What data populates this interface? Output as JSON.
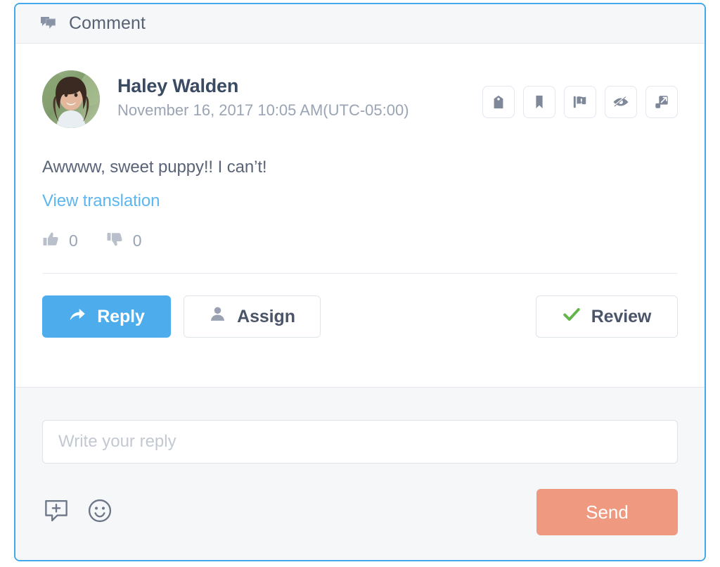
{
  "card": {
    "border_color": "#45a8ec",
    "header": {
      "icon": "comment-bubbles-icon",
      "title": "Comment"
    }
  },
  "comment": {
    "author": "Haley Walden",
    "timestamp": "November 16, 2017 10:05 AM(UTC-05:00)",
    "avatar_alt": "Haley Walden",
    "body": "Awwww, sweet puppy!! I can’t!",
    "translate_link": "View translation",
    "votes": {
      "up_icon": "thumbs-up-icon",
      "up_count": "0",
      "down_icon": "thumbs-down-icon",
      "down_count": "0"
    },
    "icon_actions": [
      {
        "name": "tag-icon",
        "title": "Tag"
      },
      {
        "name": "bookmark-icon",
        "title": "Bookmark"
      },
      {
        "name": "flag-alert-icon",
        "title": "Flag"
      },
      {
        "name": "eye-hidden-icon",
        "title": "Hide"
      },
      {
        "name": "expand-icon",
        "title": "Expand"
      }
    ]
  },
  "actions": {
    "reply_label": "Reply",
    "reply_icon": "reply-arrow-icon",
    "reply_color": "#4cacec",
    "assign_label": "Assign",
    "assign_icon": "person-icon",
    "review_label": "Review",
    "review_icon": "check-icon",
    "review_icon_color": "#62b54a"
  },
  "reply_box": {
    "placeholder": "Write your reply",
    "value": "",
    "tools": [
      {
        "name": "add-canned-response-icon",
        "title": "Insert saved reply"
      },
      {
        "name": "emoji-icon",
        "title": "Insert emoji"
      }
    ],
    "send_label": "Send",
    "send_color": "#ef9a80"
  }
}
